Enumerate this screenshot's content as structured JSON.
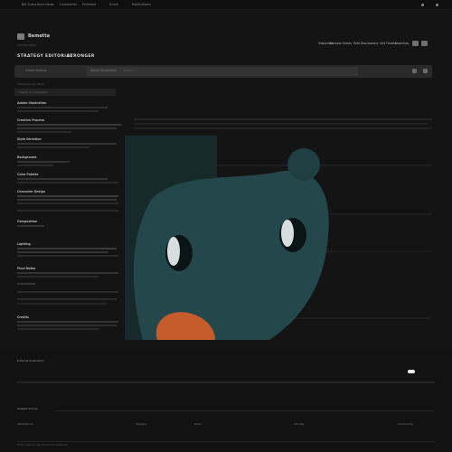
{
  "topbar": {
    "items": [
      "Bill Subscriber News",
      "Comments",
      "Pinterest",
      "Email",
      "Publications"
    ],
    "icons": [
      "play-icon",
      "more-icon"
    ]
  },
  "header": {
    "brand": "Bemetta",
    "tagline": "300 SECONDS",
    "menu": [
      "Subscribe",
      "Contact Series",
      "Past Discussions",
      "Get Tickets",
      "Searches"
    ]
  },
  "tabs": [
    "STRATEGY",
    "EDITORIAL",
    "STRONGER"
  ],
  "searchbar": {
    "left_label": "Adobe feature",
    "field_value": "Adobe Illustration",
    "placeholder": "Search"
  },
  "article": {
    "breadcrumb": "Interactive by Team",
    "input_placeholder": "Search in a template",
    "headings": [
      "Adobe Illustration",
      "Creative Process",
      "Style Direction",
      "Background",
      "Color Palette",
      "Character Design",
      "Composition",
      "Lighting",
      "Final Notes",
      "Credits"
    ]
  },
  "footer": {
    "title": "Editorial Illustration",
    "subtitle": "Related Stories",
    "columns": [
      "Illustrations",
      "Designs",
      "Tools",
      "Articles",
      "Community"
    ],
    "bottom": "Terms of Service and Community Guidelines"
  },
  "colors": {
    "background": "#141414",
    "panel": "#17292a",
    "creature": "#23474a",
    "mouth": "#c65c2b"
  }
}
